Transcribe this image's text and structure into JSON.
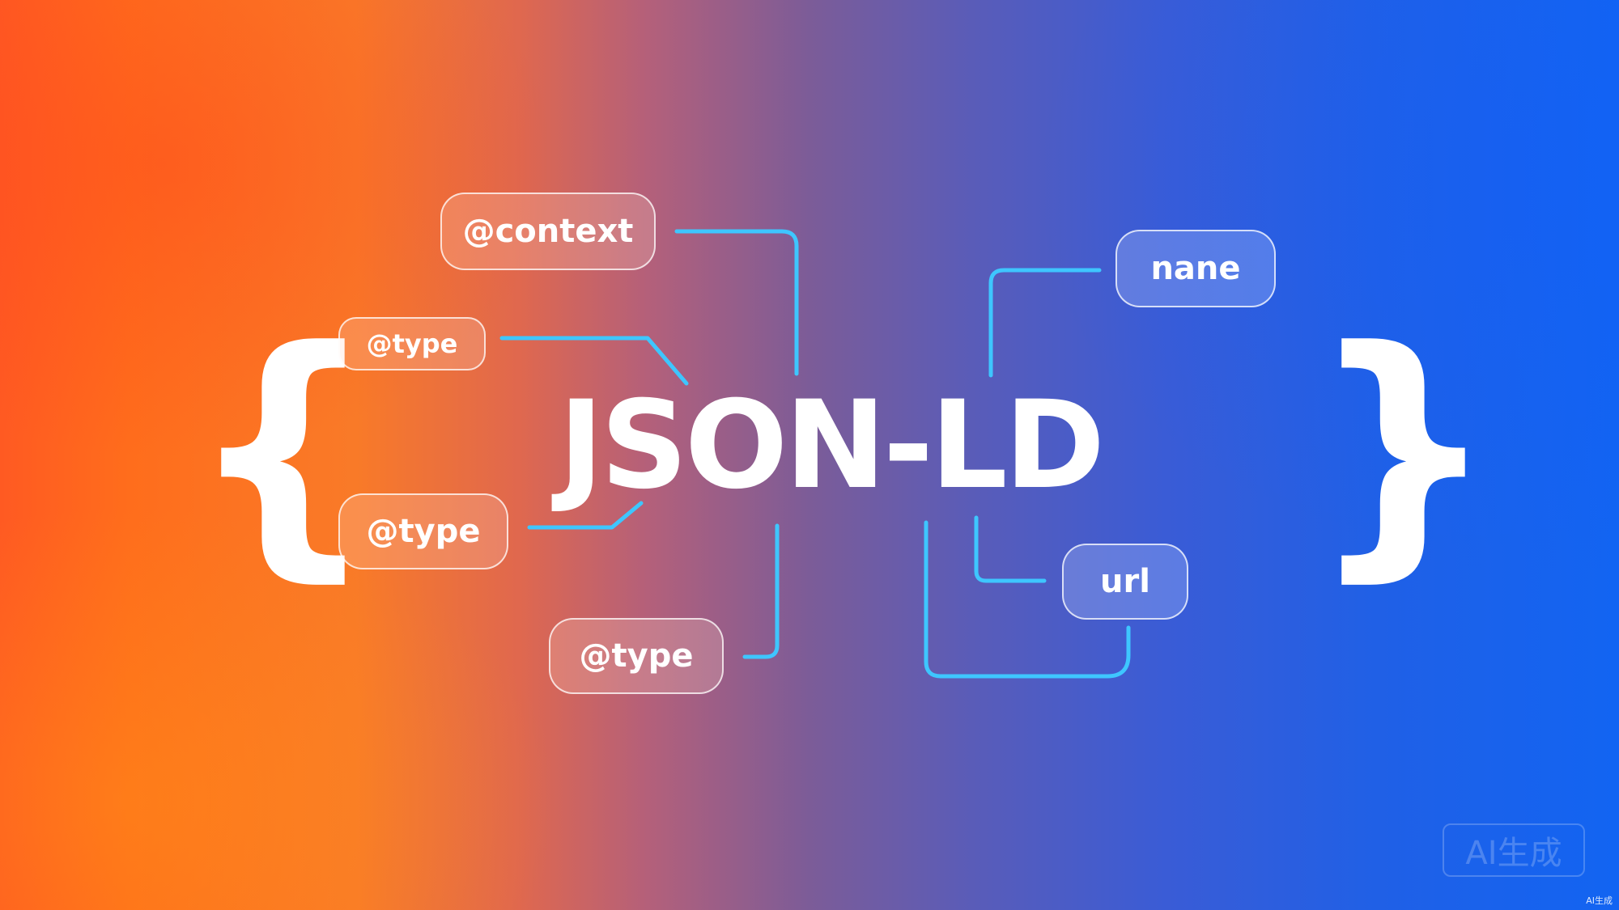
{
  "diagram": {
    "title": "JSON-LD",
    "brace_open": "{",
    "brace_close": "}",
    "nodes": {
      "context": "@context",
      "type_small": "@type",
      "type_left": "@type",
      "type_bottom": "@type",
      "name": "nane",
      "url": "url"
    },
    "connector_color": "#3ec6ff"
  },
  "watermark": {
    "label": "AI生成",
    "corner_label": "AI生成"
  }
}
